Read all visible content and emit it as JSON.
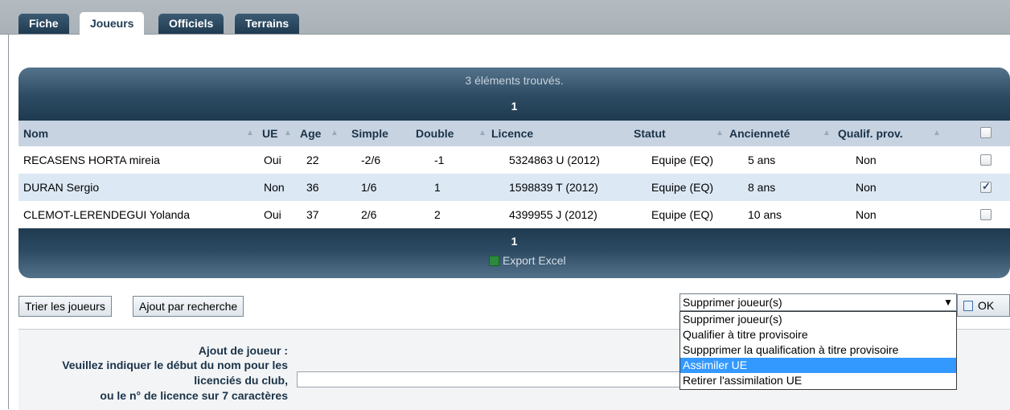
{
  "tabs": [
    {
      "label": "Fiche"
    },
    {
      "label": "Joueurs"
    },
    {
      "label": "Officiels"
    },
    {
      "label": "Terrains"
    }
  ],
  "grid": {
    "found_text": "3 éléments trouvés.",
    "page": "1",
    "columns": [
      "Nom",
      "UE",
      "Age",
      "Simple",
      "Double",
      "Licence",
      "Statut",
      "Ancienneté",
      "Qualif. prov."
    ],
    "rows": [
      {
        "nom": "RECASENS HORTA mireia",
        "ue": "Oui",
        "age": "22",
        "simple": "-2/6",
        "double": "-1",
        "licence": "5324863 U (2012)",
        "statut": "Equipe (EQ)",
        "anciennete": "5 ans",
        "qualif": "Non",
        "checked": false
      },
      {
        "nom": "DURAN Sergio",
        "ue": "Non",
        "age": "36",
        "simple": "1/6",
        "double": "1",
        "licence": "1598839 T (2012)",
        "statut": "Equipe (EQ)",
        "anciennete": "8 ans",
        "qualif": "Non",
        "checked": true
      },
      {
        "nom": "CLEMOT-LERENDEGUI Yolanda",
        "ue": "Oui",
        "age": "37",
        "simple": "2/6",
        "double": "2",
        "licence": "4399955 J (2012)",
        "statut": "Equipe (EQ)",
        "anciennete": "10 ans",
        "qualif": "Non",
        "checked": false
      }
    ],
    "export_label": "Export Excel"
  },
  "actions": {
    "sort_button": "Trier les joueurs",
    "search_add_button": "Ajout par recherche",
    "selected_action": "Supprimer joueur(s)",
    "ok_button": "OK",
    "options": [
      "Supprimer joueur(s)",
      "Qualifier à titre provisoire",
      "Suppprimer la qualification à titre provisoire",
      "Assimiler UE",
      "Retirer l'assimilation UE"
    ],
    "highlighted_option_index": 3
  },
  "add_player": {
    "title": "Ajout de joueur :",
    "line1": "Veuillez indiquer le début du nom pour les",
    "line2": "licenciés du club,",
    "line3": "ou le n° de licence sur 7 caractères"
  },
  "colors": {
    "header_dark": "#1e3a50",
    "row_alt": "#dce8f4",
    "column_header": "#c7d3e1",
    "highlight": "#3399ff"
  }
}
